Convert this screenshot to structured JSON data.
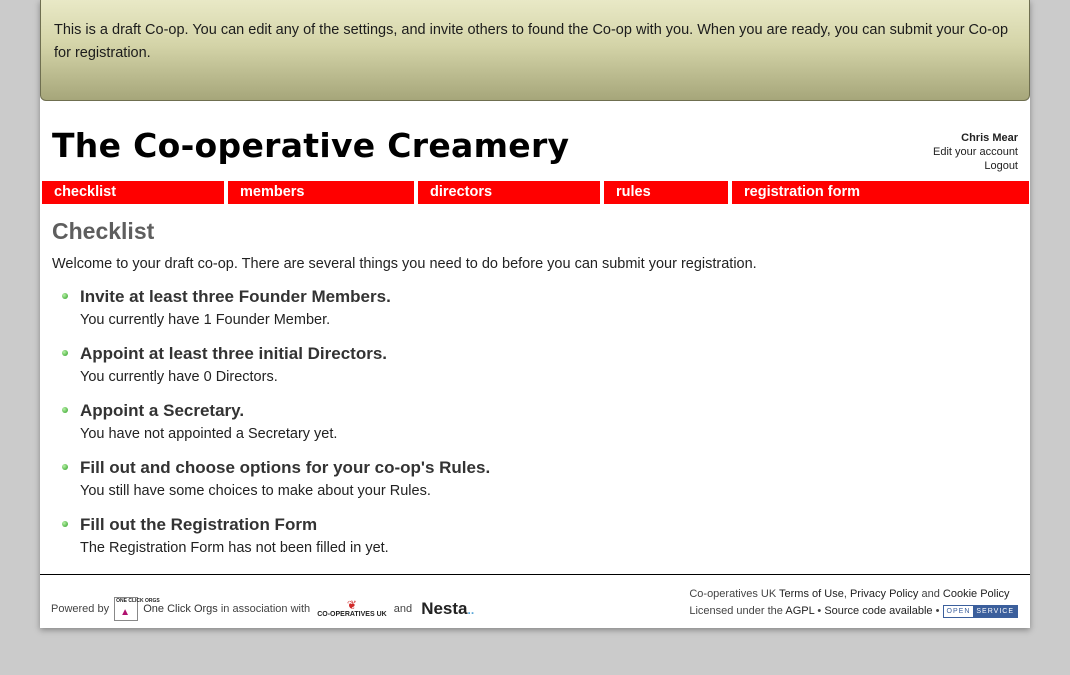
{
  "banner": {
    "text": "This is a draft Co-op. You can edit any of the settings, and invite others to found the Co-op with you. When you are ready, you can submit your Co-op for registration."
  },
  "header": {
    "site_title": "The Co-operative Creamery"
  },
  "user_menu": {
    "name": "Chris Mear",
    "edit_account": "Edit your account",
    "logout": "Logout"
  },
  "nav": {
    "items": [
      {
        "label": "checklist"
      },
      {
        "label": "members"
      },
      {
        "label": "directors"
      },
      {
        "label": "rules"
      },
      {
        "label": "registration form"
      }
    ]
  },
  "main": {
    "heading": "Checklist",
    "intro": "Welcome to your draft co-op. There are several things you need to do before you can submit your registration.",
    "items": [
      {
        "title": "Invite at least three Founder Members.",
        "status": "You currently have 1 Founder Member."
      },
      {
        "title": "Appoint at least three initial Directors.",
        "status": "You currently have 0 Directors."
      },
      {
        "title": "Appoint a Secretary.",
        "status": "You have not appointed a Secretary yet."
      },
      {
        "title": "Fill out and choose options for your co-op's Rules.",
        "status": "You still have some choices to make about your Rules."
      },
      {
        "title": "Fill out the Registration Form",
        "status": "The Registration Form has not been filled in yet."
      }
    ]
  },
  "footer": {
    "powered_by": "Powered by",
    "oco_logo_text": "ONE CLICK ORGS",
    "oco_link": "One Click Orgs",
    "in_association": "in association with",
    "coopuk_logo_text": "CO-OPERATIVES UK",
    "and": "and",
    "nesta_logo_text": "Nesta",
    "coopuk_prefix": "Co-operatives UK",
    "terms": "Terms of Use",
    "comma": ",",
    "privacy": "Privacy Policy",
    "and2": "and",
    "cookie": "Cookie Policy",
    "licensed": "Licensed under the",
    "agpl": "AGPL",
    "bullet": "•",
    "source_code": "Source code available",
    "open_a": "OPEN",
    "open_b": "SERVICE"
  },
  "colors": {
    "nav_bg": "#ff0000",
    "page_bg": "#cbcbcb",
    "bullet": "#55b64a"
  },
  "icons": [
    "cursor-icon",
    "bullet-icon"
  ]
}
